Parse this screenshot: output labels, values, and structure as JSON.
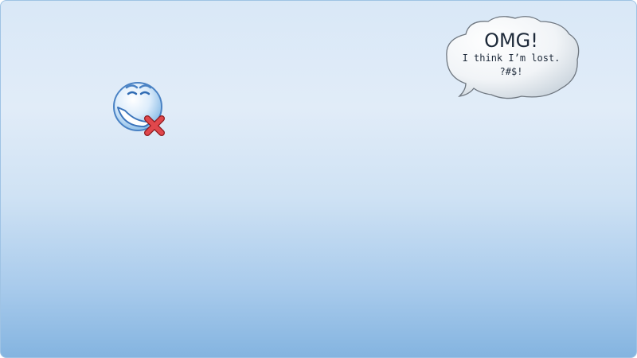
{
  "error_screen": {
    "mascot_icon": "lost-smiley-with-red-x-icon",
    "bubble": {
      "title": "OMG!",
      "line1": "I think I’m lost.",
      "line2": "?#$!"
    }
  },
  "colors": {
    "background_top": "#d9e8f7",
    "background_bottom": "#84b4e0",
    "error_x": "#d9343a"
  }
}
